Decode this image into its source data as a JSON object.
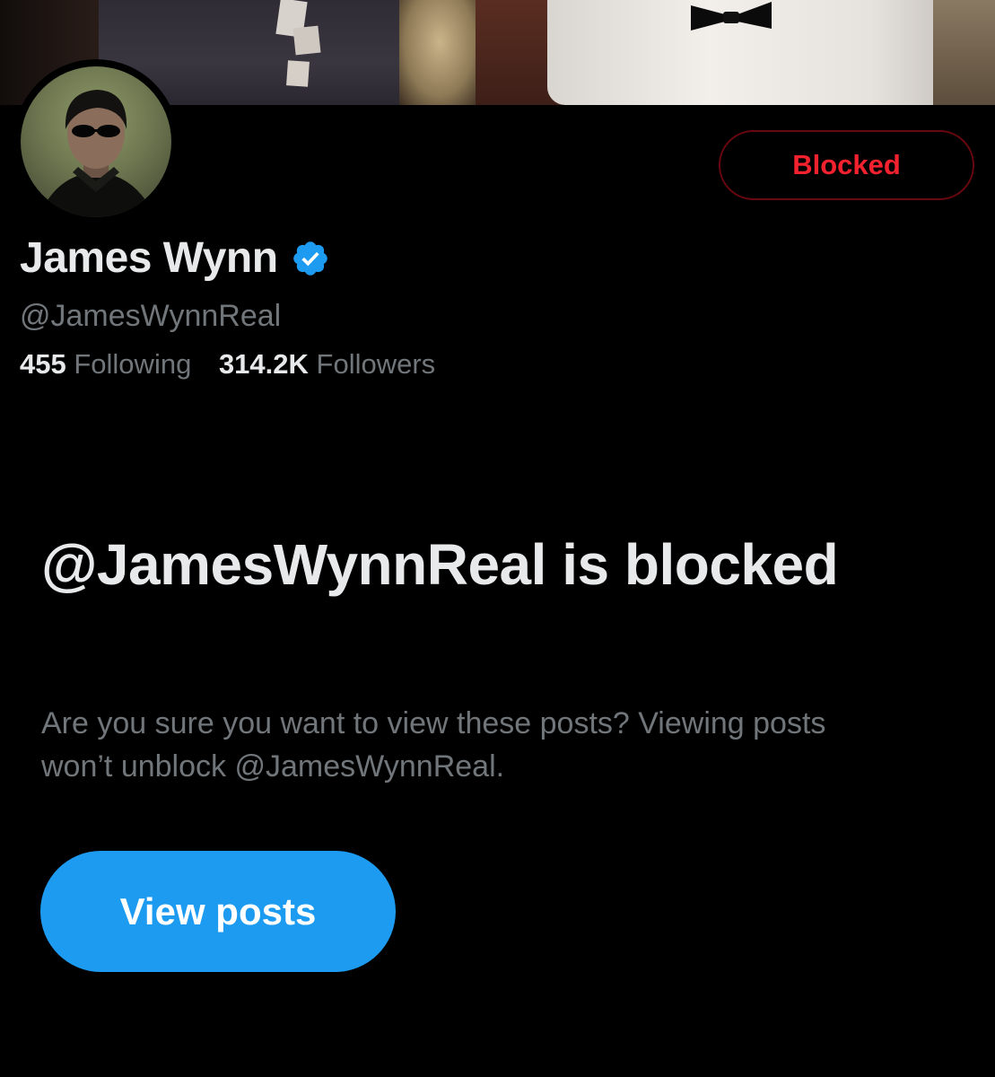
{
  "colors": {
    "background": "#000000",
    "primary_text": "#e7e9ea",
    "secondary_text": "#71767b",
    "blocked_red": "#f4212e",
    "accent_blue": "#1d9bf0",
    "verified_blue": "#1d9bf0"
  },
  "profile": {
    "display_name": "James Wynn",
    "verified": true,
    "verified_icon": "verified-badge-icon",
    "handle": "@JamesWynnReal",
    "following_count": "455",
    "following_label": "Following",
    "followers_count": "314.2K",
    "followers_label": "Followers"
  },
  "actions": {
    "blocked_label": "Blocked"
  },
  "blocked_notice": {
    "title": "@JamesWynnReal is blocked",
    "description": "Are you sure you want to view these posts? Viewing posts won’t unblock @JamesWynnReal.",
    "button_label": "View posts"
  }
}
